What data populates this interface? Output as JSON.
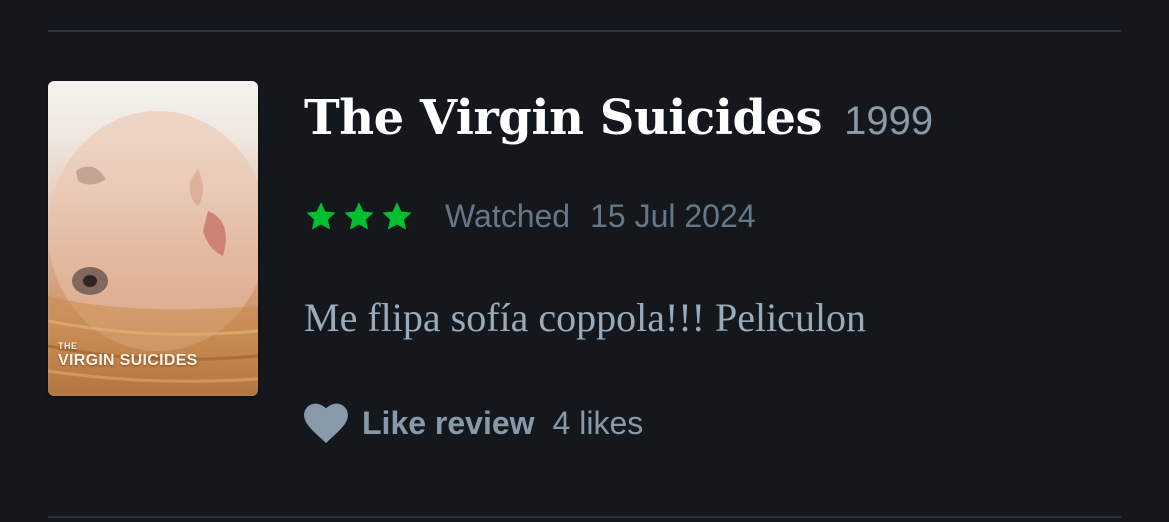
{
  "review": {
    "film": {
      "title": "The Virgin Suicides",
      "year": "1999",
      "poster": {
        "title_small": "THE",
        "title_big": "VIRGIN SUICIDES"
      }
    },
    "rating": {
      "stars": 3,
      "max": 5,
      "color": "#00c030"
    },
    "watched_label": "Watched",
    "watched_date": "15 Jul 2024",
    "text": "Me flipa sofía coppola!!! Peliculon",
    "like": {
      "icon": "heart-icon",
      "label": "Like review",
      "count_text": "4 likes"
    }
  },
  "colors": {
    "background": "#14181c",
    "divider": "#2c3440",
    "title": "#ffffff",
    "muted": "#667788",
    "review_text": "#99aabb"
  }
}
